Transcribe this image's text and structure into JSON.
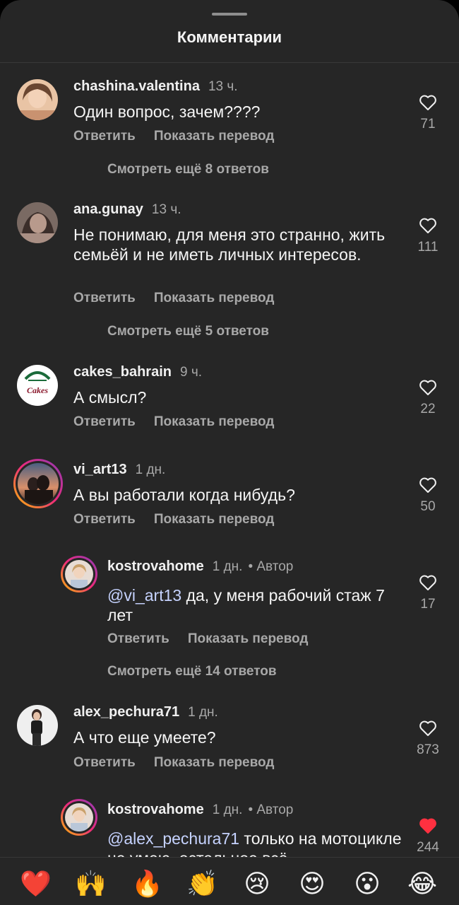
{
  "header": {
    "title": "Комментарии"
  },
  "actions": {
    "reply": "Ответить",
    "translate": "Показать перевод"
  },
  "comments": [
    {
      "username": "chashina.valentina",
      "time": "13 ч.",
      "text": "Один вопрос, зачем????",
      "likes": "71",
      "more": "Смотреть ещё 8 ответов"
    },
    {
      "username": "ana.gunay",
      "time": "13 ч.",
      "text": "Не понимаю, для меня это странно, жить семьёй и не иметь личных интересов.",
      "likes": "111",
      "more": "Смотреть ещё 5 ответов"
    },
    {
      "username": "cakes_bahrain",
      "time": "9 ч.",
      "text": "А смысл?",
      "likes": "22"
    },
    {
      "username": "vi_art13",
      "time": "1 дн.",
      "text": "А вы работали когда нибудь?",
      "likes": "50"
    },
    {
      "username": "kostrovahome",
      "time": "1 дн.",
      "author": "• Автор",
      "mention": "@vi_art13",
      "text": " да, у меня рабочий стаж 7 лет",
      "likes": "17",
      "more": "Смотреть ещё 14 ответов"
    },
    {
      "username": "alex_pechura71",
      "time": "1 дн.",
      "text": "А что еще умеете?",
      "likes": "873"
    },
    {
      "username": "kostrovahome",
      "time": "1 дн.",
      "author": "• Автор",
      "mention": "@alex_pechura71",
      "text": " только на мотоцикле не умею, остальное всё",
      "likes": "244",
      "liked": true
    }
  ],
  "avatar_text": {
    "cakes_logo": "Cakes"
  },
  "emoji_bar": [
    "❤️",
    "🙌",
    "🔥",
    "👏",
    "😢",
    "😍",
    "😮",
    "😂"
  ],
  "colors": {
    "background": "#262626",
    "like_active": "#ff3040",
    "muted": "#a8a8a8"
  }
}
